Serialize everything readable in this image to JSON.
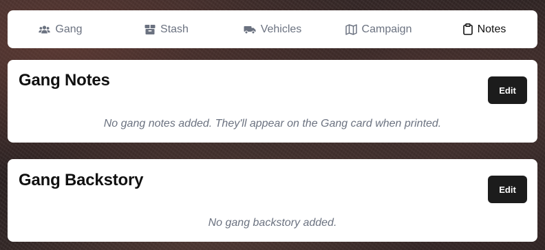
{
  "tabs": [
    {
      "label": "Gang",
      "icon": "users-icon"
    },
    {
      "label": "Stash",
      "icon": "box-icon"
    },
    {
      "label": "Vehicles",
      "icon": "truck-icon"
    },
    {
      "label": "Campaign",
      "icon": "map-icon"
    },
    {
      "label": "Notes",
      "icon": "clipboard-icon",
      "active": true
    }
  ],
  "notes_card": {
    "title": "Gang Notes",
    "edit_label": "Edit",
    "empty_message": "No gang notes added. They'll appear on the Gang card when printed."
  },
  "backstory_card": {
    "title": "Gang Backstory",
    "edit_label": "Edit",
    "empty_message": "No gang backstory added."
  },
  "colors": {
    "active_tab": "#111111",
    "inactive_tab": "#6b7280",
    "button_bg": "#1c1c1c",
    "card_bg": "#ffffff"
  }
}
